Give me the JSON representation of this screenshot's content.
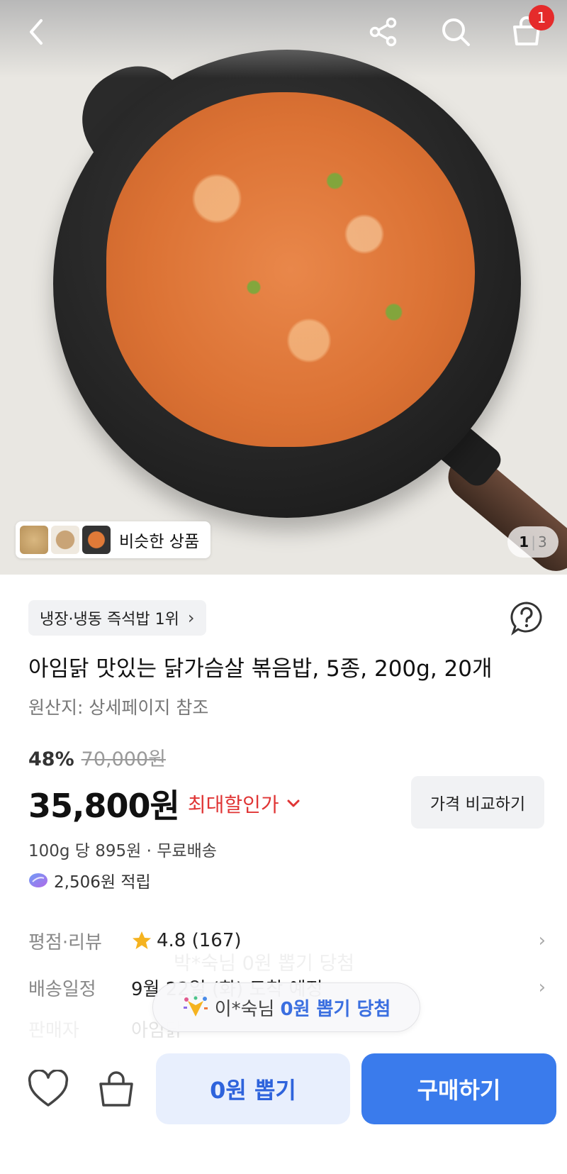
{
  "top_bar": {
    "cart_count": "1"
  },
  "hero": {
    "similar_label": "비슷한 상품",
    "page_current": "1",
    "page_separator": "|",
    "page_total": "3"
  },
  "product": {
    "rank_label": "냉장·냉동 즉석밥 1위",
    "title": "아임닭 맛있는 닭가슴살 볶음밥, 5종, 200g, 20개",
    "origin": "원산지: 상세페이지 참조",
    "discount_rate": "48%",
    "original_price": "70,000원",
    "price": "35,800원",
    "max_discount_label": "최대할인가",
    "compare_button": "가격 비교하기",
    "unit_price": "100g 당 895원 · 무료배송",
    "points": "2,506원 적립"
  },
  "info_rows": {
    "review_key": "평점·리뷰",
    "rating": "4.8 (167)",
    "shipping_key": "배송일정",
    "shipping_value": "9월 22일 (화) 도착 예정",
    "faded_key": "판매자",
    "faded_value": "아임닭"
  },
  "toast": {
    "ghost_text": "박*숙님 0원 뽑기 당첨",
    "name": "이*숙님",
    "win": "0원 뽑기 당첨"
  },
  "bottom_bar": {
    "draw_button": "0원 뽑기",
    "buy_button": "구매하기"
  },
  "colors": {
    "accent_blue": "#3a7bec",
    "discount_red": "#e03535",
    "badge_red": "#e52b2b"
  },
  "icons": [
    "back-icon",
    "share-icon",
    "search-icon",
    "cart-icon",
    "help-icon",
    "star-icon",
    "points-icon",
    "heart-icon",
    "shopping-bag-icon",
    "chevron-right-icon",
    "chevron-down-icon",
    "confetti-icon"
  ]
}
